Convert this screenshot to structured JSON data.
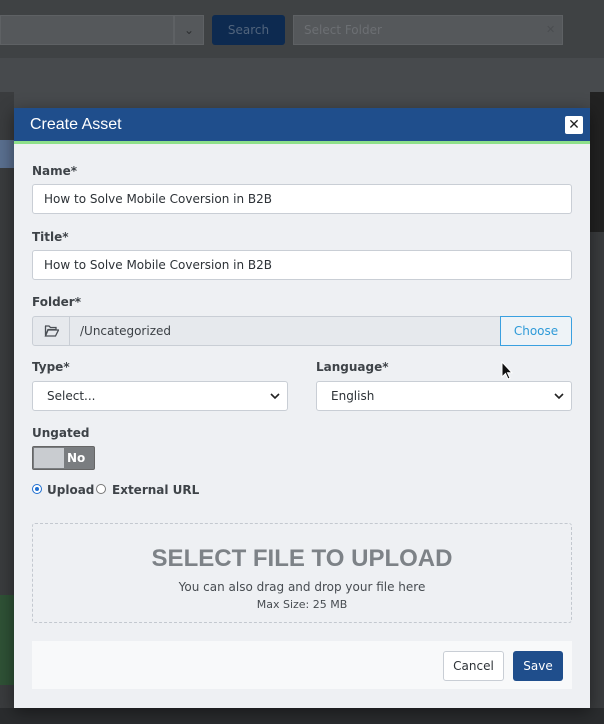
{
  "background": {
    "search_button_label": "Search",
    "folder_select_placeholder": "Select Folder"
  },
  "modal": {
    "title": "Create Asset",
    "close_label": "✕",
    "name": {
      "label": "Name*",
      "value": "How to Solve Mobile Coversion in B2B"
    },
    "title_field": {
      "label": "Title*",
      "value": "How to Solve Mobile Coversion in B2B"
    },
    "folder": {
      "label": "Folder*",
      "path": "/Uncategorized",
      "choose_label": "Choose",
      "icon": "folder-open-icon"
    },
    "type": {
      "label": "Type*",
      "selected": "Select..."
    },
    "language": {
      "label": "Language*",
      "selected": "English"
    },
    "ungated": {
      "label": "Ungated",
      "state_label": "No",
      "on": false
    },
    "source": {
      "options": [
        {
          "label": "Upload",
          "checked": true
        },
        {
          "label": "External URL",
          "checked": false
        }
      ]
    },
    "dropzone": {
      "title": "SELECT FILE TO UPLOAD",
      "subtitle": "You can also drag and drop your file here",
      "max_size": "Max Size: 25 MB"
    },
    "footer": {
      "cancel_label": "Cancel",
      "save_label": "Save"
    }
  },
  "colors": {
    "header": "#1f4e8c",
    "accent_line": "#8ee08a",
    "choose_border": "#3aa0e0",
    "save_button": "#1f4e8c"
  }
}
